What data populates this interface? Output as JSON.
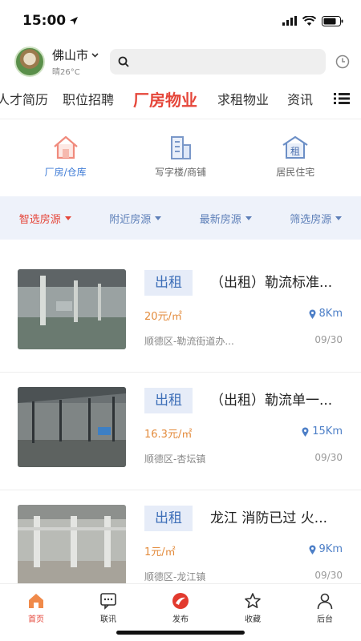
{
  "status": {
    "time": "15:00"
  },
  "header": {
    "city": "佛山市",
    "weather": "晴26°C",
    "search_placeholder": ""
  },
  "nav": {
    "tabs": [
      {
        "label": "人才简历"
      },
      {
        "label": "职位招聘"
      },
      {
        "label": "厂房物业"
      },
      {
        "label": "求租物业"
      },
      {
        "label": "资讯"
      }
    ]
  },
  "categories": [
    {
      "label": "厂房/仓库"
    },
    {
      "label": "写字楼/商铺"
    },
    {
      "label": "居民住宅",
      "icon_text": "租"
    }
  ],
  "filters": [
    {
      "label": "智选房源"
    },
    {
      "label": "附近房源"
    },
    {
      "label": "最新房源"
    },
    {
      "label": "筛选房源"
    }
  ],
  "listings": [
    {
      "tag": "出租",
      "title": "（出租）勒流标准...",
      "price": "20元/㎡",
      "distance": "8Km",
      "location": "顺德区-勒流街道办...",
      "date": "09/30"
    },
    {
      "tag": "出租",
      "title": "（出租）勒流单一...",
      "price": "16.3元/㎡",
      "distance": "15Km",
      "location": "顺德区-杏坛镇",
      "date": "09/30"
    },
    {
      "tag": "出租",
      "title": "龙江 消防已过 火...",
      "price": "1元/㎡",
      "distance": "9Km",
      "location": "顺德区-龙江镇",
      "date": "09/30"
    }
  ],
  "tabbar": [
    {
      "label": "首页"
    },
    {
      "label": "联讯"
    },
    {
      "label": "发布"
    },
    {
      "label": "收藏"
    },
    {
      "label": "后台"
    }
  ],
  "colors": {
    "accent": "#e5463a",
    "blue": "#3e7bd6",
    "price": "#e38b3c"
  }
}
